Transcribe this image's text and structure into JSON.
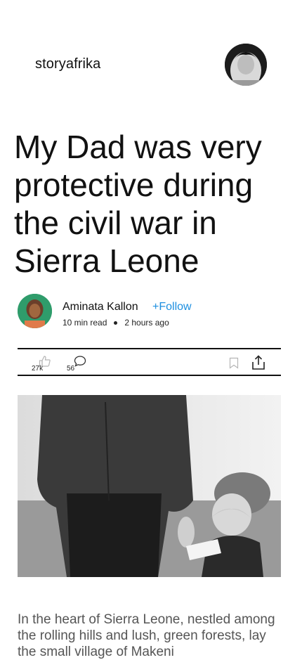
{
  "header": {
    "brand": "storyafrika"
  },
  "article": {
    "title": "My Dad was very protective during the civil war in Sierra Leone",
    "author": {
      "name": "Aminata Kallon",
      "follow_label": "+Follow",
      "read_time": "10 min read",
      "posted": "2 hours ago"
    },
    "actions": {
      "likes": "27k",
      "comments": "56"
    },
    "body": "In the heart of Sierra Leone, nestled among the rolling hills and lush, green forests, lay the small village of Makeni"
  },
  "colors": {
    "accent": "#1d8fe0",
    "text": "#111111",
    "body_text": "#555555"
  },
  "icons": [
    "user-avatar-icon",
    "author-avatar-icon",
    "like-icon",
    "comment-icon",
    "bookmark-icon",
    "share-icon"
  ]
}
